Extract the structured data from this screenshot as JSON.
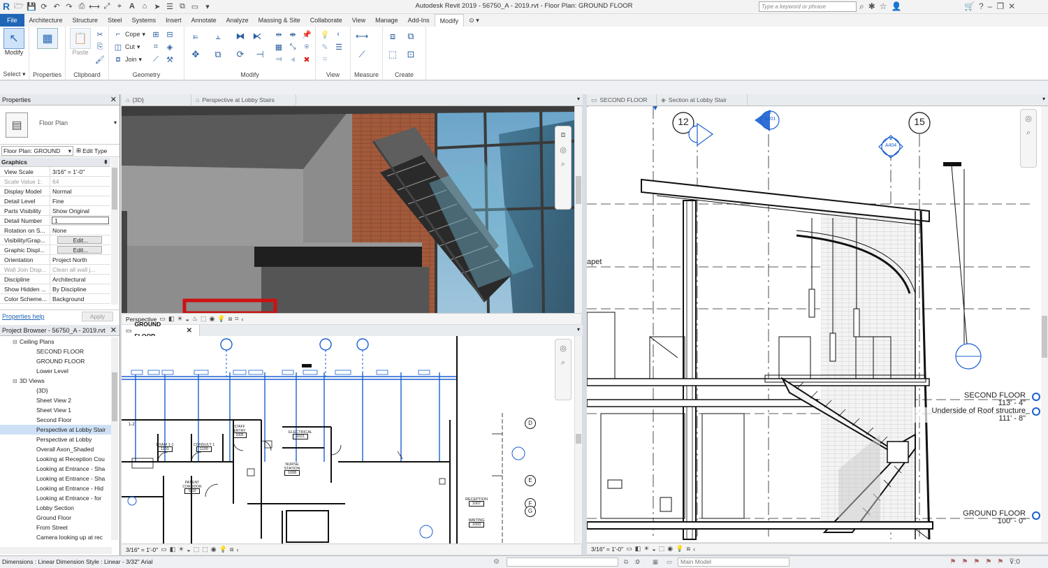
{
  "title_bar": {
    "title": "Autodesk Revit 2019 - 56750_A - 2019.rvt - Floor Plan: GROUND FLOOR",
    "search_placeholder": "Type a keyword or phrase",
    "app_logo": "R"
  },
  "ribbon_tabs": [
    "File",
    "Architecture",
    "Structure",
    "Steel",
    "Systems",
    "Insert",
    "Annotate",
    "Analyze",
    "Massing & Site",
    "Collaborate",
    "View",
    "Manage",
    "Add-Ins",
    "Modify"
  ],
  "active_tab": "Modify",
  "ribbon": {
    "select": {
      "button": "Modify",
      "label": "Select"
    },
    "properties": {
      "button": "Properties",
      "label": "Properties"
    },
    "clipboard": {
      "paste": "Paste",
      "label": "Clipboard"
    },
    "geometry": {
      "cope": "Cope",
      "cut": "Cut",
      "join": "Join",
      "label": "Geometry"
    },
    "modify": {
      "label": "Modify"
    },
    "view": {
      "label": "View"
    },
    "measure": {
      "label": "Measure"
    },
    "create": {
      "label": "Create"
    }
  },
  "properties": {
    "header": "Properties",
    "type_name": "Floor Plan",
    "instance_selector": "Floor Plan: GROUND",
    "edit_type": "Edit Type",
    "group": "Graphics",
    "rows": [
      {
        "key": "View Scale",
        "value": "3/16\" = 1'-0\""
      },
      {
        "key": "Scale Value    1:",
        "value": "64"
      },
      {
        "key": "Display Model",
        "value": "Normal"
      },
      {
        "key": "Detail Level",
        "value": "Fine"
      },
      {
        "key": "Parts Visibility",
        "value": "Show Original"
      },
      {
        "key": "Detail Number",
        "value": "1"
      },
      {
        "key": "Rotation on S...",
        "value": "None"
      },
      {
        "key": "Visibility/Grap...",
        "value": "Edit..."
      },
      {
        "key": "Graphic Displ...",
        "value": "Edit..."
      },
      {
        "key": "Orientation",
        "value": "Project North"
      },
      {
        "key": "Wall Join Disp...",
        "value": "Clean all wall j..."
      },
      {
        "key": "Discipline",
        "value": "Architectural"
      },
      {
        "key": "Show Hidden ...",
        "value": "By Discipline"
      },
      {
        "key": "Color Scheme...",
        "value": "Background"
      }
    ],
    "help_link": "Properties help",
    "apply_button": "Apply"
  },
  "project_browser": {
    "header": "Project Browser - 56750_A - 2019.rvt",
    "items": [
      {
        "label": "Ceiling Plans",
        "level": 1,
        "expander": "⊟"
      },
      {
        "label": "SECOND FLOOR",
        "level": 2
      },
      {
        "label": "GROUND FLOOR",
        "level": 2
      },
      {
        "label": "Lower Level",
        "level": 2
      },
      {
        "label": "3D Views",
        "level": 1,
        "expander": "⊟"
      },
      {
        "label": "{3D}",
        "level": 2
      },
      {
        "label": "Sheet View 2",
        "level": 2
      },
      {
        "label": "Sheet View 1",
        "level": 2
      },
      {
        "label": "Second Floor",
        "level": 2
      },
      {
        "label": "Perspective at Lobby Stair",
        "level": 2,
        "selected": true
      },
      {
        "label": "Perspective at Lobby",
        "level": 2
      },
      {
        "label": "Overall Axon_Shaded",
        "level": 2
      },
      {
        "label": "Looking at Reception Cou",
        "level": 2
      },
      {
        "label": "Looking at Entrance - Sha",
        "level": 2
      },
      {
        "label": "Looking at Entrance - Sha",
        "level": 2
      },
      {
        "label": "Looking at Entrance - Hid",
        "level": 2
      },
      {
        "label": "Looking at Entrance - for",
        "level": 2
      },
      {
        "label": "Lobby Section",
        "level": 2
      },
      {
        "label": "Ground Floor",
        "level": 2
      },
      {
        "label": "From Street",
        "level": 2
      },
      {
        "label": "Camera looking up at rec",
        "level": 2
      }
    ]
  },
  "views": {
    "top_left_tabs": [
      {
        "label": "{3D}",
        "active": false
      },
      {
        "label": "Perspective at Lobby Stairs",
        "active": false
      }
    ],
    "bottom_left_tab": "GROUND FLOOR",
    "right_tabs": [
      {
        "label": "SECOND FLOOR",
        "active": false
      },
      {
        "label": "Section at Lobby Stair",
        "active": false
      }
    ],
    "persp_control": "Perspective",
    "plan_scale": "3/16\" = 1'-0\"",
    "section_scale": "3/16\" = 1'-0\""
  },
  "plan": {
    "rooms": [
      {
        "name": "EXAM 1-1",
        "num": "1101"
      },
      {
        "name": "CONSULT 1",
        "num": "1100"
      },
      {
        "name": "STAFF ENTRY",
        "num": "1005"
      },
      {
        "name": "ELECTRICAL",
        "num": "1021"
      },
      {
        "name": "NURSE STATION",
        "num": "1008"
      },
      {
        "name": "PATIENT CORRIDOR",
        "num": "1010"
      },
      {
        "name": "RECEPTION",
        "num": "1007"
      },
      {
        "name": "WAITING",
        "num": "1003"
      }
    ],
    "grid_heads": [
      "D",
      "E",
      "F",
      "G"
    ]
  },
  "section": {
    "grid_heads": [
      "12",
      "15"
    ],
    "section_tags": [
      {
        "num": "3",
        "sheet": "A401"
      },
      {
        "num": "4",
        "sheet": "A404"
      }
    ],
    "parapet_label": "apet",
    "levels": [
      {
        "name": "SECOND FLOOR",
        "elev": "113' - 4\""
      },
      {
        "name": "Underside of Roof structure",
        "elev": "111' - 8\""
      },
      {
        "name": "GROUND FLOOR",
        "elev": "100' - 0\""
      }
    ]
  },
  "status_bar": {
    "message": "Dimensions : Linear Dimension Style : Linear - 3/32\" Arial",
    "counter": ":0",
    "model": "Main Model"
  },
  "colors": {
    "accent": "#1f66b6",
    "grid_blue": "#1a5fd0",
    "red_frame": "#cc1111"
  }
}
